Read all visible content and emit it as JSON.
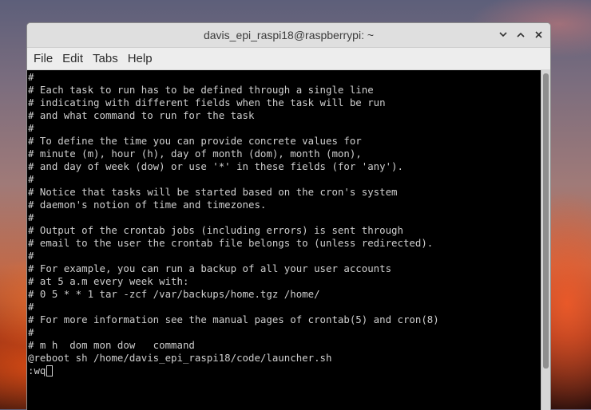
{
  "window": {
    "title": "davis_epi_raspi18@raspberrypi: ~",
    "buttons": {
      "minimize": "⌄",
      "maximize": "⌃",
      "close": "✕"
    }
  },
  "menubar": {
    "items": [
      "File",
      "Edit",
      "Tabs",
      "Help"
    ]
  },
  "terminal": {
    "lines": [
      "#",
      "# Each task to run has to be defined through a single line",
      "# indicating with different fields when the task will be run",
      "# and what command to run for the task",
      "#",
      "# To define the time you can provide concrete values for",
      "# minute (m), hour (h), day of month (dom), month (mon),",
      "# and day of week (dow) or use '*' in these fields (for 'any').",
      "#",
      "# Notice that tasks will be started based on the cron's system",
      "# daemon's notion of time and timezones.",
      "#",
      "# Output of the crontab jobs (including errors) is sent through",
      "# email to the user the crontab file belongs to (unless redirected).",
      "#",
      "# For example, you can run a backup of all your user accounts",
      "# at 5 a.m every week with:",
      "# 0 5 * * 1 tar -zcf /var/backups/home.tgz /home/",
      "#",
      "# For more information see the manual pages of crontab(5) and cron(8)",
      "#",
      "# m h  dom mon dow   command",
      "@reboot sh /home/davis_epi_raspi18/code/launcher.sh"
    ],
    "command_line": ":wq"
  }
}
